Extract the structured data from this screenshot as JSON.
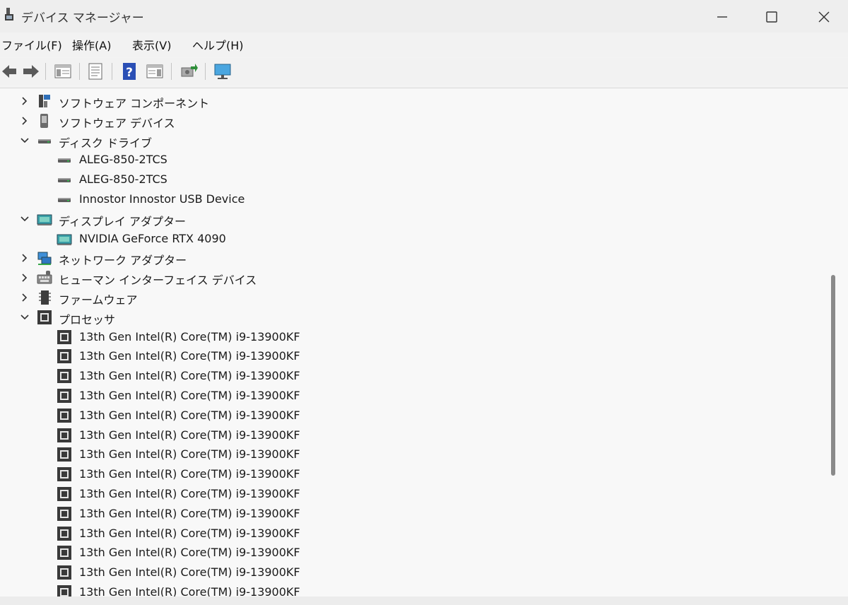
{
  "window": {
    "title": "デバイス マネージャー"
  },
  "menu": [
    {
      "label": "ファイル(F)"
    },
    {
      "label": "操作(A)"
    },
    {
      "label": "表示(V)"
    },
    {
      "label": "ヘルプ(H)"
    }
  ],
  "tree": [
    {
      "label": "ソフトウェア コンポーネント",
      "level": 1,
      "state": "collapsed",
      "icon": "software-component-icon"
    },
    {
      "label": "ソフトウェア デバイス",
      "level": 1,
      "state": "collapsed",
      "icon": "software-device-icon"
    },
    {
      "label": "ディスク ドライブ",
      "level": 1,
      "state": "expanded",
      "icon": "disk-drive-icon"
    },
    {
      "label": "ALEG-850-2TCS",
      "level": 2,
      "icon": "disk-drive-icon"
    },
    {
      "label": "ALEG-850-2TCS",
      "level": 2,
      "icon": "disk-drive-icon"
    },
    {
      "label": "Innostor Innostor USB Device",
      "level": 2,
      "icon": "disk-drive-icon"
    },
    {
      "label": "ディスプレイ アダプター",
      "level": 1,
      "state": "expanded",
      "icon": "display-adapter-icon"
    },
    {
      "label": "NVIDIA GeForce RTX 4090",
      "level": 2,
      "icon": "display-adapter-icon"
    },
    {
      "label": "ネットワーク アダプター",
      "level": 1,
      "state": "collapsed",
      "icon": "network-adapter-icon"
    },
    {
      "label": "ヒューマン インターフェイス デバイス",
      "level": 1,
      "state": "collapsed",
      "icon": "hid-icon"
    },
    {
      "label": "ファームウェア",
      "level": 1,
      "state": "collapsed",
      "icon": "firmware-icon"
    },
    {
      "label": "プロセッサ",
      "level": 1,
      "state": "expanded",
      "icon": "processor-icon"
    },
    {
      "label": "13th Gen Intel(R) Core(TM) i9-13900KF",
      "level": 2,
      "icon": "processor-icon"
    },
    {
      "label": "13th Gen Intel(R) Core(TM) i9-13900KF",
      "level": 2,
      "icon": "processor-icon"
    },
    {
      "label": "13th Gen Intel(R) Core(TM) i9-13900KF",
      "level": 2,
      "icon": "processor-icon"
    },
    {
      "label": "13th Gen Intel(R) Core(TM) i9-13900KF",
      "level": 2,
      "icon": "processor-icon"
    },
    {
      "label": "13th Gen Intel(R) Core(TM) i9-13900KF",
      "level": 2,
      "icon": "processor-icon"
    },
    {
      "label": "13th Gen Intel(R) Core(TM) i9-13900KF",
      "level": 2,
      "icon": "processor-icon"
    },
    {
      "label": "13th Gen Intel(R) Core(TM) i9-13900KF",
      "level": 2,
      "icon": "processor-icon"
    },
    {
      "label": "13th Gen Intel(R) Core(TM) i9-13900KF",
      "level": 2,
      "icon": "processor-icon"
    },
    {
      "label": "13th Gen Intel(R) Core(TM) i9-13900KF",
      "level": 2,
      "icon": "processor-icon"
    },
    {
      "label": "13th Gen Intel(R) Core(TM) i9-13900KF",
      "level": 2,
      "icon": "processor-icon"
    },
    {
      "label": "13th Gen Intel(R) Core(TM) i9-13900KF",
      "level": 2,
      "icon": "processor-icon"
    },
    {
      "label": "13th Gen Intel(R) Core(TM) i9-13900KF",
      "level": 2,
      "icon": "processor-icon"
    },
    {
      "label": "13th Gen Intel(R) Core(TM) i9-13900KF",
      "level": 2,
      "icon": "processor-icon"
    },
    {
      "label": "13th Gen Intel(R) Core(TM) i9-13900KF",
      "level": 2,
      "icon": "processor-icon"
    }
  ]
}
